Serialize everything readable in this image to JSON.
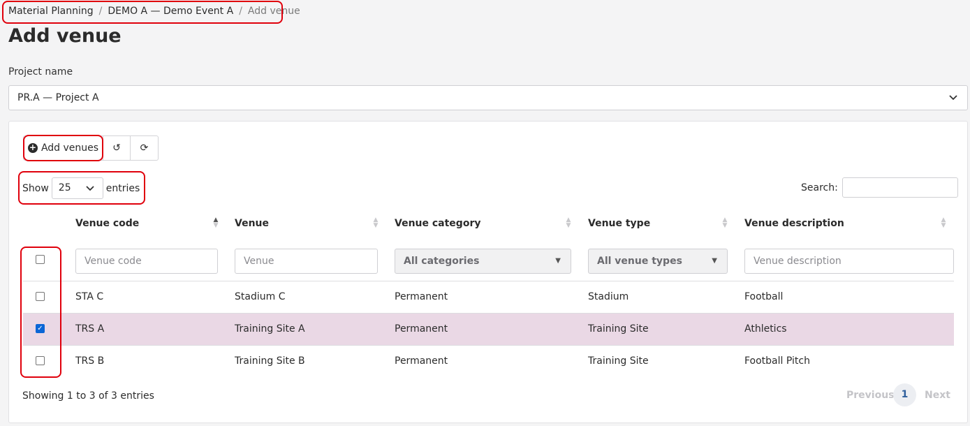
{
  "breadcrumb": {
    "items": [
      "Material Planning",
      "DEMO A — Demo Event A"
    ],
    "active": "Add venue",
    "separator": "/"
  },
  "page": {
    "title": "Add venue"
  },
  "project": {
    "label": "Project name",
    "value": "PR.A — Project A",
    "chevron": "⌄"
  },
  "toolbar": {
    "add_label": "Add venues",
    "reset_icon": "↺",
    "reload_icon": "⟳"
  },
  "length": {
    "show": "Show",
    "value": "25",
    "entries": "entries"
  },
  "search": {
    "label": "Search:"
  },
  "table": {
    "columns": [
      "Venue code",
      "Venue",
      "Venue category",
      "Venue type",
      "Venue description"
    ],
    "filters": {
      "code": "Venue code",
      "venue": "Venue",
      "category": "All categories",
      "type": "All venue types",
      "description": "Venue description"
    },
    "rows": [
      {
        "code": "STA C",
        "venue": "Stadium C",
        "category": "Permanent",
        "type": "Stadium",
        "description": "Football",
        "checked": false
      },
      {
        "code": "TRS A",
        "venue": "Training Site A",
        "category": "Permanent",
        "type": "Training Site",
        "description": "Athletics",
        "checked": true
      },
      {
        "code": "TRS B",
        "venue": "Training Site B",
        "category": "Permanent",
        "type": "Training Site",
        "description": "Football Pitch",
        "checked": false
      }
    ]
  },
  "footer": {
    "info": "Showing 1 to 3 of 3 entries",
    "previous": "Previous",
    "page": "1",
    "next": "Next"
  },
  "colors": {
    "highlight": "#e0000c",
    "selected_row": "#ead8e5",
    "checkbox_checked": "#0b66d6"
  }
}
